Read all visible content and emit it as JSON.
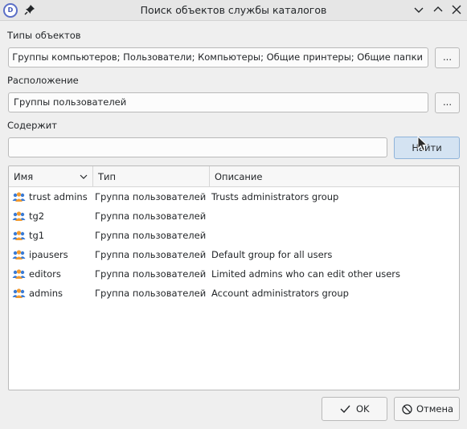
{
  "window": {
    "title": "Поиск объектов службы каталогов",
    "app_icon_text": "D"
  },
  "object_types": {
    "label": "Типы объектов",
    "value": "Группы пользователей; Группы компьютеров; Пользователи; Компьютеры; Общие принтеры; Общие папки",
    "browse_label": "..."
  },
  "location": {
    "label": "Расположение",
    "value": "Группы пользователей",
    "browse_label": "..."
  },
  "contains": {
    "label": "Содержит",
    "value": "",
    "find_label": "Найти"
  },
  "table": {
    "columns": [
      "Имя",
      "Тип",
      "Описание"
    ],
    "rows": [
      {
        "name": "trust admins",
        "type": "Группа пользователей",
        "description": "Trusts administrators group"
      },
      {
        "name": "tg2",
        "type": "Группа пользователей",
        "description": ""
      },
      {
        "name": "tg1",
        "type": "Группа пользователей",
        "description": ""
      },
      {
        "name": "ipausers",
        "type": "Группа пользователей",
        "description": "Default group for all users"
      },
      {
        "name": "editors",
        "type": "Группа пользователей",
        "description": "Limited admins who can edit other users"
      },
      {
        "name": "admins",
        "type": "Группа пользователей",
        "description": "Account administrators group"
      }
    ]
  },
  "footer": {
    "ok_label": "OK",
    "cancel_label": "Отмена"
  },
  "icons": {
    "app": "domain-app-icon",
    "pin": "pin-icon",
    "minimize": "chevron-down-icon",
    "maximize": "chevron-up-icon",
    "close": "close-icon",
    "row": "user-group-icon",
    "sort": "sort-down-icon",
    "ok": "checkmark-icon",
    "cancel": "cancel-circle-icon"
  },
  "colors": {
    "accent": "#3daee9",
    "primary_button": "#d4e3f2",
    "group_icon_blue": "#3a7bd5",
    "group_icon_orange": "#f29b30"
  }
}
